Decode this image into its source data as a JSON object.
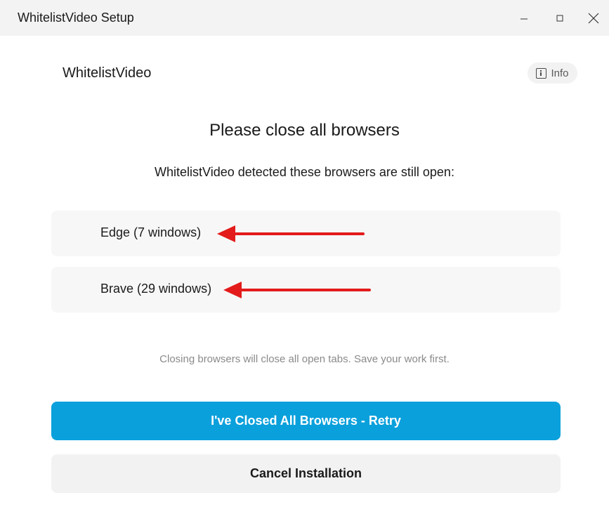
{
  "window": {
    "title": "WhitelistVideo Setup",
    "controls": [
      "minimize-icon",
      "maximize-icon",
      "close-icon"
    ]
  },
  "header": {
    "app_name": "WhitelistVideo",
    "info_label": "Info",
    "info_icon": "info-icon"
  },
  "main": {
    "heading": "Please close all browsers",
    "subheading": "WhitelistVideo detected these browsers are still open:",
    "browsers": [
      {
        "label": "Edge (7 windows)"
      },
      {
        "label": "Brave (29 windows)"
      }
    ],
    "annotation_arrow_color": "#e31b1b",
    "note": "Closing browsers will close all open tabs. Save your work first."
  },
  "actions": {
    "retry_label": "I've Closed All Browsers - Retry",
    "retry_color": "#0aa0dc",
    "cancel_label": "Cancel Installation"
  }
}
